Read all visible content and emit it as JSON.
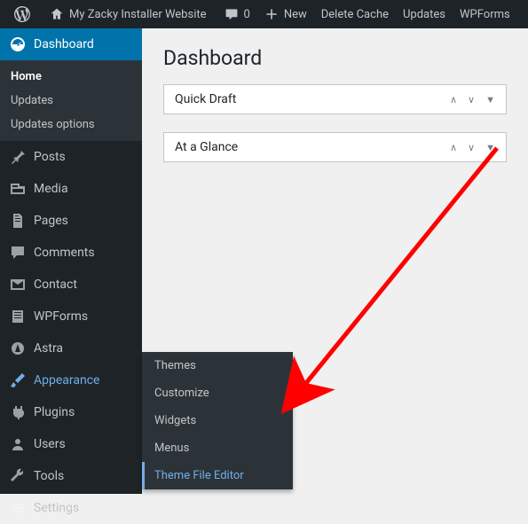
{
  "toolbar": {
    "site_name": "My Zacky Installer Website",
    "comments_count": "0",
    "new_label": "New",
    "delete_cache": "Delete Cache",
    "updates": "Updates",
    "wpforms": "WPForms"
  },
  "sidebar": {
    "dashboard": "Dashboard",
    "sub": {
      "home": "Home",
      "updates": "Updates",
      "updates_options": "Updates options"
    },
    "posts": "Posts",
    "media": "Media",
    "pages": "Pages",
    "comments": "Comments",
    "contact": "Contact",
    "wpforms": "WPForms",
    "astra": "Astra",
    "appearance": "Appearance",
    "plugins": "Plugins",
    "users": "Users",
    "tools": "Tools",
    "settings": "Settings"
  },
  "flyout": {
    "themes": "Themes",
    "customize": "Customize",
    "widgets": "Widgets",
    "menus": "Menus",
    "theme_file_editor": "Theme File Editor"
  },
  "main": {
    "title": "Dashboard",
    "panel1": "Quick Draft",
    "panel2": "At a Glance"
  }
}
